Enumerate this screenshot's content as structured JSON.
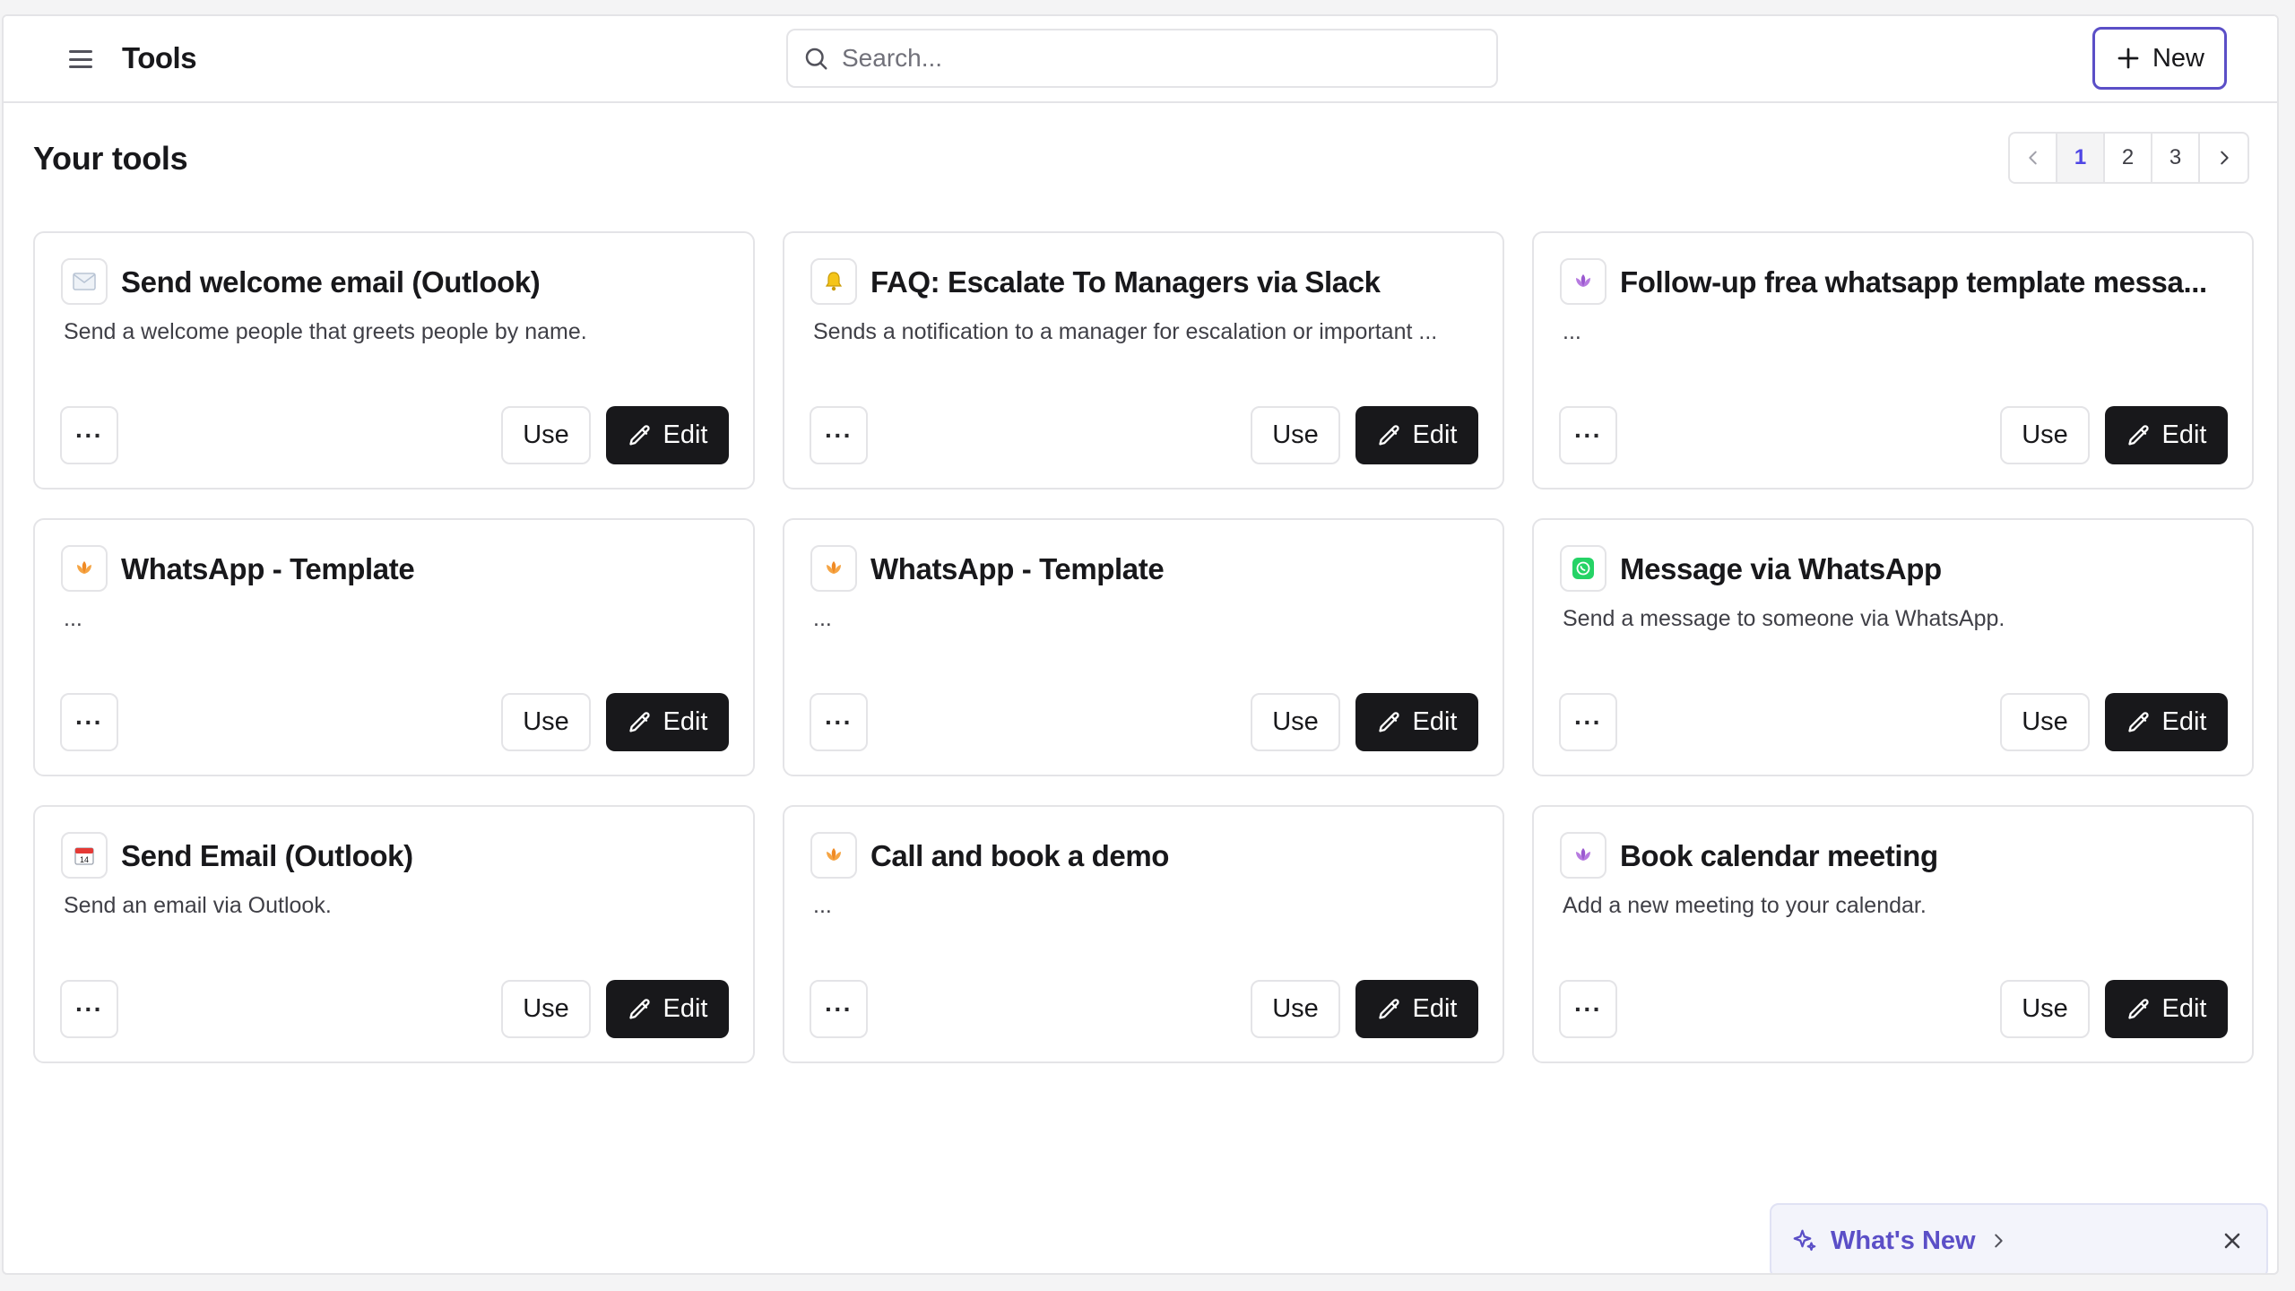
{
  "header": {
    "title": "Tools",
    "menu_icon": "hamburger-menu-icon",
    "search_placeholder": "Search...",
    "new_label": "New",
    "accent_color": "#5b4fc7"
  },
  "section": {
    "title": "Your tools",
    "pagination": {
      "pages": [
        "1",
        "2",
        "3"
      ],
      "current": "1"
    }
  },
  "tools": [
    {
      "icon": "envelope-icon",
      "title": "Send welcome email (Outlook)",
      "description": "Send a welcome people that greets people by name.",
      "more_label": "···",
      "use_label": "Use",
      "edit_label": "Edit"
    },
    {
      "icon": "bell-icon",
      "title": "FAQ: Escalate To Managers via Slack",
      "description": "Sends a notification to a manager for escalation or important ...",
      "more_label": "···",
      "use_label": "Use",
      "edit_label": "Edit"
    },
    {
      "icon": "purple-lotus-icon",
      "title": "Follow-up frea whatsapp template messa...",
      "description": "...",
      "more_label": "···",
      "use_label": "Use",
      "edit_label": "Edit"
    },
    {
      "icon": "orange-flame-icon",
      "title": "WhatsApp - Template",
      "description": "...",
      "more_label": "···",
      "use_label": "Use",
      "edit_label": "Edit"
    },
    {
      "icon": "orange-flame-icon",
      "title": "WhatsApp - Template",
      "description": "...",
      "more_label": "···",
      "use_label": "Use",
      "edit_label": "Edit"
    },
    {
      "icon": "whatsapp-icon",
      "title": "Message via WhatsApp",
      "description": "Send a message to someone via WhatsApp.",
      "more_label": "···",
      "use_label": "Use",
      "edit_label": "Edit"
    },
    {
      "icon": "calendar-icon",
      "title": "Send Email (Outlook)",
      "description": "Send an email via Outlook.",
      "more_label": "···",
      "use_label": "Use",
      "edit_label": "Edit"
    },
    {
      "icon": "orange-flame-icon",
      "title": "Call and book a demo",
      "description": "...",
      "more_label": "···",
      "use_label": "Use",
      "edit_label": "Edit"
    },
    {
      "icon": "purple-lotus-icon",
      "title": "Book calendar meeting",
      "description": "Add a new meeting to your calendar.",
      "more_label": "···",
      "use_label": "Use",
      "edit_label": "Edit"
    }
  ],
  "whats_new": {
    "label": "What's New"
  }
}
